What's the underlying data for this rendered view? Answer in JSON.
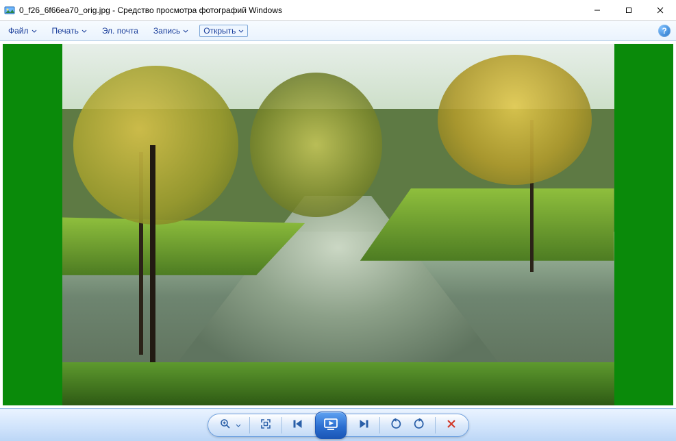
{
  "window": {
    "title": "0_f26_6f66ea70_orig.jpg - Средство просмотра фотографий Windows"
  },
  "menu": {
    "file": "Файл",
    "print": "Печать",
    "email": "Эл. почта",
    "burn": "Запись",
    "open": "Открыть"
  },
  "help": {
    "symbol": "?"
  },
  "colors": {
    "letterbox": "#0a8a0a",
    "menu_text": "#1a3e9b",
    "control_accent": "#2a5fa8"
  },
  "image": {
    "description": "Autumn park scene with a winding pond/river, grassy banks, and yellow-green foliage trees reflected in calm water",
    "letterbox": "green pillarbox on left and right"
  }
}
